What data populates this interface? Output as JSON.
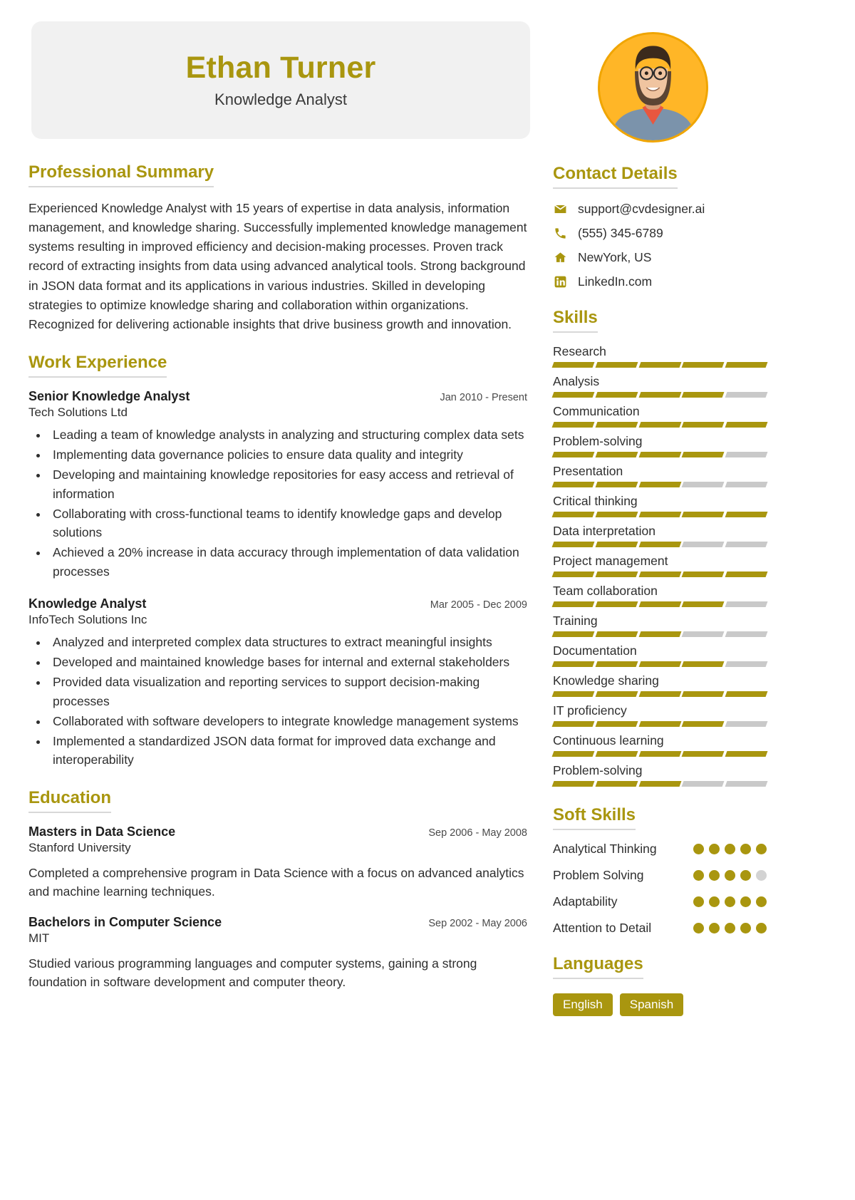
{
  "theme": {
    "accent": "#a9960f",
    "bar_empty": "#c9c9c9",
    "card_bg": "#f1f1f1"
  },
  "header": {
    "name": "Ethan Turner",
    "job_title": "Knowledge Analyst",
    "avatar_alt": "profile-photo"
  },
  "summary": {
    "title": "Professional Summary",
    "text": "Experienced Knowledge Analyst with 15 years of expertise in data analysis, information management, and knowledge sharing. Successfully implemented knowledge management systems resulting in improved efficiency and decision-making processes. Proven track record of extracting insights from data using advanced analytical tools. Strong background in JSON data format and its applications in various industries. Skilled in developing strategies to optimize knowledge sharing and collaboration within organizations. Recognized for delivering actionable insights that drive business growth and innovation."
  },
  "work": {
    "title": "Work Experience",
    "jobs": [
      {
        "role": "Senior Knowledge Analyst",
        "date": "Jan 2010 - Present",
        "company": "Tech Solutions Ltd",
        "bullets": [
          "Leading a team of knowledge analysts in analyzing and structuring complex data sets",
          "Implementing data governance policies to ensure data quality and integrity",
          "Developing and maintaining knowledge repositories for easy access and retrieval of information",
          "Collaborating with cross-functional teams to identify knowledge gaps and develop solutions",
          "Achieved a 20% increase in data accuracy through implementation of data validation processes"
        ]
      },
      {
        "role": "Knowledge Analyst",
        "date": "Mar 2005 - Dec 2009",
        "company": "InfoTech Solutions Inc",
        "bullets": [
          "Analyzed and interpreted complex data structures to extract meaningful insights",
          "Developed and maintained knowledge bases for internal and external stakeholders",
          "Provided data visualization and reporting services to support decision-making processes",
          "Collaborated with software developers to integrate knowledge management systems",
          "Implemented a standardized JSON data format for improved data exchange and interoperability"
        ]
      }
    ]
  },
  "education": {
    "title": "Education",
    "items": [
      {
        "degree": "Masters in Data Science",
        "date": "Sep 2006 - May 2008",
        "school": "Stanford University",
        "description": "Completed a comprehensive program in Data Science with a focus on advanced analytics and machine learning techniques."
      },
      {
        "degree": "Bachelors in Computer Science",
        "date": "Sep 2002 - May 2006",
        "school": "MIT",
        "description": "Studied various programming languages and computer systems, gaining a strong foundation in software development and computer theory."
      }
    ]
  },
  "contact": {
    "title": "Contact Details",
    "items": [
      {
        "icon": "envelope-icon",
        "value": "support@cvdesigner.ai"
      },
      {
        "icon": "phone-icon",
        "value": "(555) 345-6789"
      },
      {
        "icon": "home-icon",
        "value": "NewYork, US"
      },
      {
        "icon": "linkedin-icon",
        "value": "LinkedIn.com"
      }
    ]
  },
  "skills": {
    "title": "Skills",
    "max": 5,
    "items": [
      {
        "name": "Research",
        "level": 5
      },
      {
        "name": "Analysis",
        "level": 4
      },
      {
        "name": "Communication",
        "level": 5
      },
      {
        "name": "Problem-solving",
        "level": 4
      },
      {
        "name": "Presentation",
        "level": 3
      },
      {
        "name": "Critical thinking",
        "level": 5
      },
      {
        "name": "Data interpretation",
        "level": 3
      },
      {
        "name": "Project management",
        "level": 5
      },
      {
        "name": "Team collaboration",
        "level": 4
      },
      {
        "name": "Training",
        "level": 3
      },
      {
        "name": "Documentation",
        "level": 4
      },
      {
        "name": "Knowledge sharing",
        "level": 5
      },
      {
        "name": "IT proficiency",
        "level": 4
      },
      {
        "name": "Continuous learning",
        "level": 5
      },
      {
        "name": "Problem-solving",
        "level": 3
      }
    ]
  },
  "soft_skills": {
    "title": "Soft Skills",
    "max": 5,
    "items": [
      {
        "name": "Analytical Thinking",
        "level": 5
      },
      {
        "name": "Problem Solving",
        "level": 4
      },
      {
        "name": "Adaptability",
        "level": 5
      },
      {
        "name": "Attention to Detail",
        "level": 5
      }
    ]
  },
  "languages": {
    "title": "Languages",
    "items": [
      "English",
      "Spanish"
    ]
  }
}
